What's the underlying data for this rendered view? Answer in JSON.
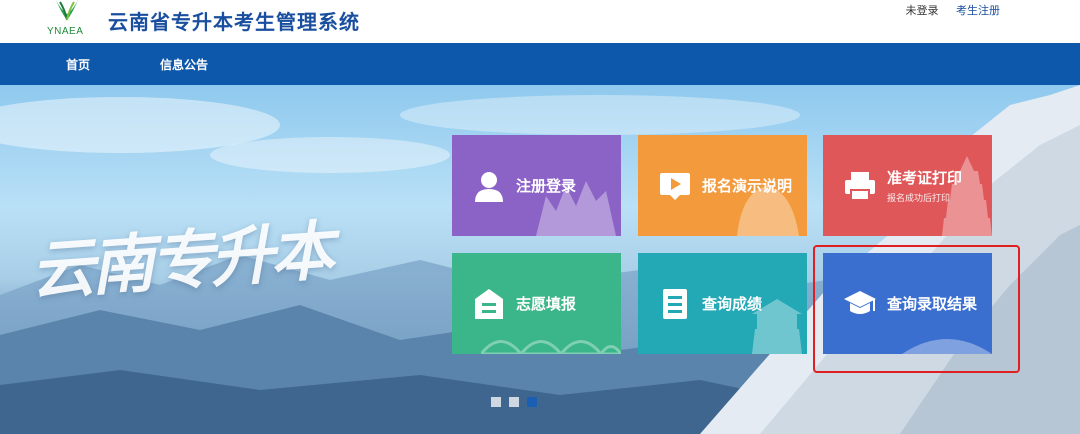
{
  "header": {
    "logo_text": "YNAEA",
    "title": "云南省专升本考生管理系统",
    "login_status": "未登录",
    "register_link": "考生注册"
  },
  "nav": {
    "items": [
      {
        "label": "首页"
      },
      {
        "label": "信息公告"
      }
    ]
  },
  "banner": {
    "slogan": "云南专升本",
    "carousel_dots": 3,
    "active_dot": 3
  },
  "tiles": [
    {
      "label": "注册登录",
      "icon": "user-icon",
      "color": "#8b62c6"
    },
    {
      "label": "报名演示说明",
      "icon": "video-play-icon",
      "color": "#f39a3c"
    },
    {
      "label": "准考证打印",
      "sub": "报名成功后打印",
      "icon": "printer-icon",
      "color": "#e0575a"
    },
    {
      "label": "志愿填报",
      "icon": "form-icon",
      "color": "#3bb58a"
    },
    {
      "label": "查询成绩",
      "icon": "document-icon",
      "color": "#23a8b5"
    },
    {
      "label": "查询录取结果",
      "icon": "graduation-cap-icon",
      "color": "#3a6fd0"
    }
  ],
  "colors": {
    "nav_bg": "#0e58ac",
    "title": "#1a4fa0",
    "highlight": "#e02020"
  }
}
